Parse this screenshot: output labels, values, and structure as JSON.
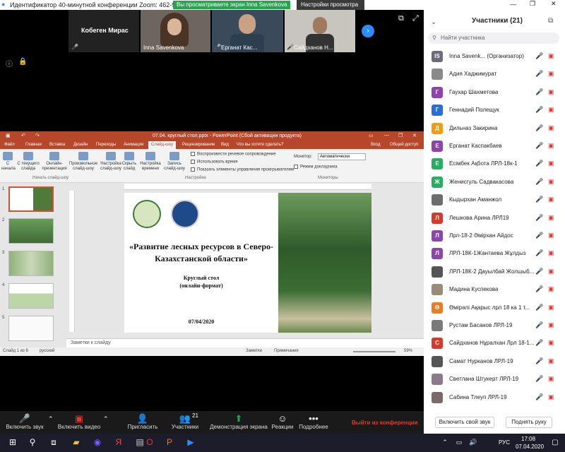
{
  "window": {
    "title": "Идентификатор 40-минутной конференции Zoom: 462-986-3837",
    "share_banner": "Вы просматриваете экран Inna Savenkova",
    "view_options": "Настройки просмотра"
  },
  "tiles": [
    {
      "name": "Кобеген Мирас"
    },
    {
      "name": "Inna Savenkova"
    },
    {
      "name": "Ерганат Кас..."
    },
    {
      "name": "Сайдханов Н..."
    }
  ],
  "ppt": {
    "title": "07.04. круглый стол.pptx - PowerPoint (Сбой активации продукта)",
    "tabs": [
      "Файл",
      "Главная",
      "Вставка",
      "Дизайн",
      "Переходы",
      "Анимация",
      "Слайд-шоу",
      "Рецензирование",
      "Вид"
    ],
    "tell_me": "Что вы хотите сделать?",
    "login": "Вход",
    "share": "Общий доступ",
    "ribbon": {
      "b1": "С начала",
      "b2": "С текущего слайда",
      "b3": "Онлайн-презентация",
      "b4": "Произвольное слайд-шоу",
      "group1": "Начать слайд-шоу",
      "b5": "Настройка слайд-шоу",
      "b6": "Скрыть слайд",
      "b7": "Настройка времени",
      "b8": "Запись слайд-шоу",
      "c1": "Воспроизвести речевое сопровождение",
      "c2": "Использовать время",
      "c3": "Показать элементы управления проигрывателем",
      "group2": "Настройка",
      "monitor_label": "Монитор:",
      "monitor_value": "Автоматически",
      "presenter": "Режим докладчика",
      "group3": "Мониторы"
    },
    "slide": {
      "title": "«Развитие лесных ресурсов в Северо-Казахстанской области»",
      "subtitle1": "Круглый стол",
      "subtitle2": "(онлайн-формат)",
      "date": "07/04/2020"
    },
    "thumb_numbers": [
      "1",
      "2",
      "3",
      "4",
      "5"
    ],
    "notes": "Заметки к слайду",
    "status": {
      "slide": "Слайд 1 из 8",
      "lang": "русский",
      "notes": "Заметки",
      "comments": "Примечания",
      "zoom": "59%"
    }
  },
  "panel": {
    "title": "Участники (21)",
    "search_placeholder": "Найти участника",
    "participants": [
      {
        "initials": "IS",
        "name": "Inna Savenk... (Организатор)",
        "color": "#6b6b7a"
      },
      {
        "initials": "",
        "name": "Адия Хаджимурат",
        "color": "#8a8a8a"
      },
      {
        "initials": "Г",
        "name": "Гаухар Шахметова",
        "color": "#8e44ad"
      },
      {
        "initials": "Г",
        "name": "Геннадий Полещук",
        "color": "#2b6fd6"
      },
      {
        "initials": "Д",
        "name": "Дильназ Закирина",
        "color": "#f39c12"
      },
      {
        "initials": "Е",
        "name": "Ерганат Каспакбаев",
        "color": "#8e44ad"
      },
      {
        "initials": "Е",
        "name": "Есімбек Ақбота ЛРЛ-18к-1",
        "color": "#27ae60"
      },
      {
        "initials": "Ж",
        "name": "Женисгуль Садвакасова",
        "color": "#27ae60"
      },
      {
        "initials": "",
        "name": "Кыдырхан Аманжол",
        "color": "#6d6d6d"
      },
      {
        "initials": "Л",
        "name": "Лешкова Арина ЛРЛ19",
        "color": "#d63a2b"
      },
      {
        "initials": "Л",
        "name": "Лрл-18-2 Әмірхан Айдос",
        "color": "#8e44ad"
      },
      {
        "initials": "Л",
        "name": "ЛРЛ-18К-1Жантаева Жұлдыз",
        "color": "#8e44ad"
      },
      {
        "initials": "",
        "name": "ЛРЛ-18К-2 Дауылбай Жолшыб...",
        "color": "#555"
      },
      {
        "initials": "",
        "name": "Мадина Куспекова",
        "color": "#9a8a7a"
      },
      {
        "initials": "Ө",
        "name": "Өмірәлі Ақарыс  лрл 18 ка 1 т...",
        "color": "#e67e22"
      },
      {
        "initials": "",
        "name": "Рустам Басанов ЛРЛ-19",
        "color": "#7a7a7a"
      },
      {
        "initials": "С",
        "name": "Сайдханов Нұралхан Лрл 18-1...",
        "color": "#d63a2b"
      },
      {
        "initials": "",
        "name": "Самат Нурканов ЛРЛ-19",
        "color": "#555"
      },
      {
        "initials": "",
        "name": "Светлана Штукерт ЛРЛ-19",
        "color": "#8a7a8a"
      },
      {
        "initials": "",
        "name": "Сабина Тлеуп ЛРЛ-19",
        "color": "#7a6a6a"
      }
    ],
    "unmute_self": "Включить свой звук",
    "raise_hand": "Поднять руку"
  },
  "controls": {
    "unmute": "Включить звук",
    "video": "Включить видео",
    "invite": "Пригласить",
    "participants": "Участники",
    "participants_count": "21",
    "share": "Демонстрация экрана",
    "reactions": "Реакции",
    "more": "Подробнее",
    "leave": "Выйти из конференции"
  },
  "taskbar": {
    "lang": "РУС",
    "time": "17:08",
    "date": "07.04.2020"
  }
}
